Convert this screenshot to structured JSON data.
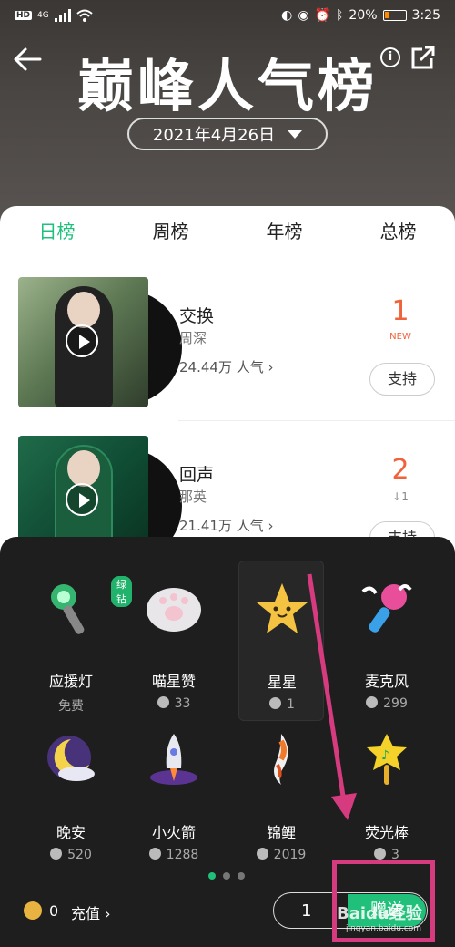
{
  "status_bar": {
    "network_badge": "HD",
    "signal_label": "4G",
    "battery_percent": "20%",
    "time": "3:25"
  },
  "header": {
    "title": "巅峰人气榜",
    "date_selector": "2021年4月26日",
    "info_icon": "i"
  },
  "tabs": [
    {
      "label": "日榜",
      "active": true
    },
    {
      "label": "周榜",
      "active": false
    },
    {
      "label": "年榜",
      "active": false
    },
    {
      "label": "总榜",
      "active": false
    }
  ],
  "songs": [
    {
      "title": "交换",
      "artist": "周深",
      "popularity": "24.44万 人气",
      "rank": "1",
      "rank_tag": "NEW",
      "support": "支持"
    },
    {
      "title": "回声",
      "artist": "那英",
      "popularity": "21.41万 人气",
      "rank": "2",
      "rank_tag": "↓1",
      "support": "支持"
    }
  ],
  "gifts": [
    {
      "name": "应援灯",
      "price": "免费",
      "badge": "绿钻",
      "icon": "light-stick-icon"
    },
    {
      "name": "喵星赞",
      "price": "33",
      "icon": "cat-paw-icon"
    },
    {
      "name": "星星",
      "price": "1",
      "icon": "star-icon",
      "selected": true
    },
    {
      "name": "麦克风",
      "price": "299",
      "icon": "microphone-icon"
    },
    {
      "name": "晚安",
      "price": "520",
      "icon": "moon-icon"
    },
    {
      "name": "小火箭",
      "price": "1288",
      "icon": "rocket-icon"
    },
    {
      "name": "锦鲤",
      "price": "2019",
      "icon": "koi-icon"
    },
    {
      "name": "荧光棒",
      "price": "3",
      "icon": "glow-stick-icon"
    }
  ],
  "pager": {
    "pages": 3,
    "current": 1
  },
  "footer": {
    "balance": "0",
    "recharge": "充值",
    "quantity": "1",
    "send_label": "赠送"
  },
  "watermark": {
    "main": "Baidu经验",
    "sub": "jingyan.baidu.com"
  },
  "colors": {
    "accent": "#1ec07d",
    "rank_red": "#f0623b",
    "annotation": "#d63b7f"
  }
}
